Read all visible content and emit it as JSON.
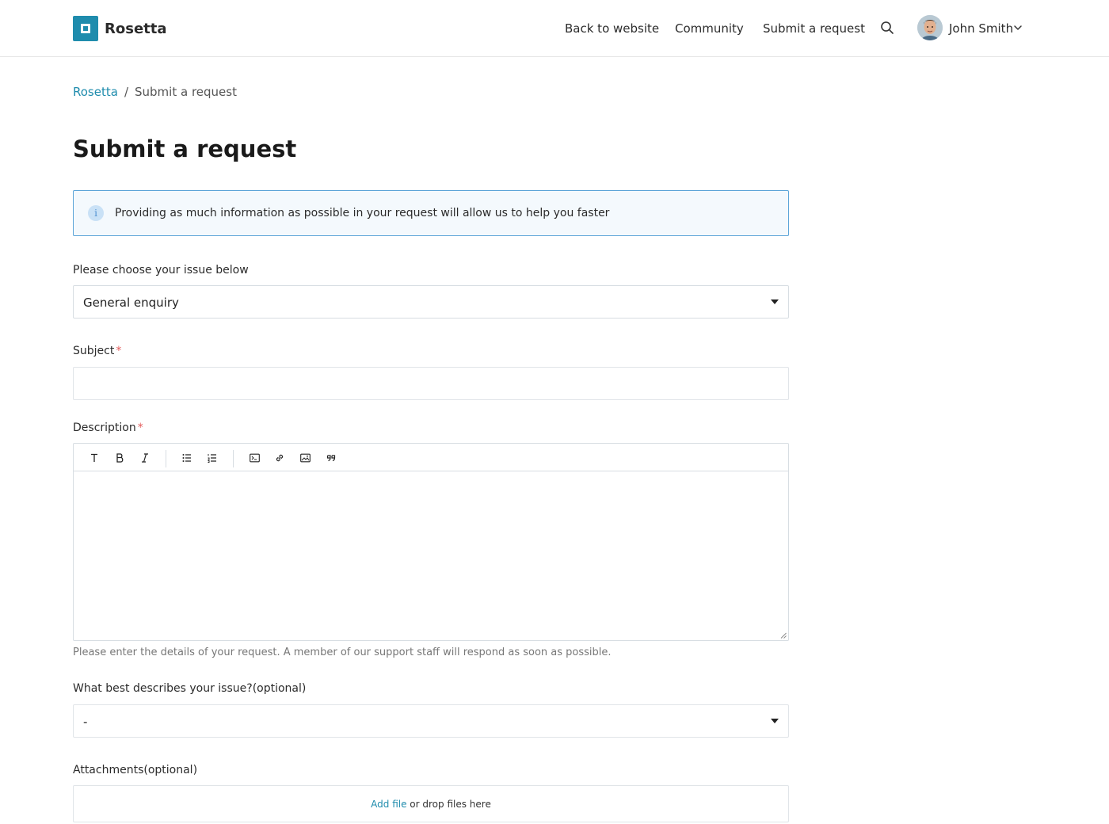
{
  "brand": {
    "name": "Rosetta",
    "accent": "#1f8cad"
  },
  "nav": {
    "back": "Back to website",
    "community": "Community",
    "submit": "Submit a request",
    "user": "John Smith"
  },
  "breadcrumb": {
    "root": "Rosetta",
    "sep": "/",
    "current": "Submit a request"
  },
  "page": {
    "title": "Submit a request"
  },
  "info": {
    "icon": "i",
    "text": "Providing as much information as possible in your request will allow us to help you faster"
  },
  "form": {
    "issue": {
      "label": "Please choose your issue below",
      "value": "General enquiry"
    },
    "subject": {
      "label": "Subject",
      "required": "*",
      "value": ""
    },
    "description": {
      "label": "Description",
      "required": "*",
      "hint": "Please enter the details of your request. A member of our support staff will respond as soon as possible.",
      "toolbar": [
        "text-format-icon",
        "bold-icon",
        "italic-icon",
        "bulleted-list-icon",
        "numbered-list-icon",
        "code-block-icon",
        "link-icon",
        "image-icon",
        "quote-icon"
      ]
    },
    "category": {
      "label": "What best describes your issue?",
      "optional": "(optional)",
      "value": "-"
    },
    "attachments": {
      "label": "Attachments",
      "optional": "(optional)",
      "add": "Add file",
      "drop": " or drop files here"
    }
  }
}
